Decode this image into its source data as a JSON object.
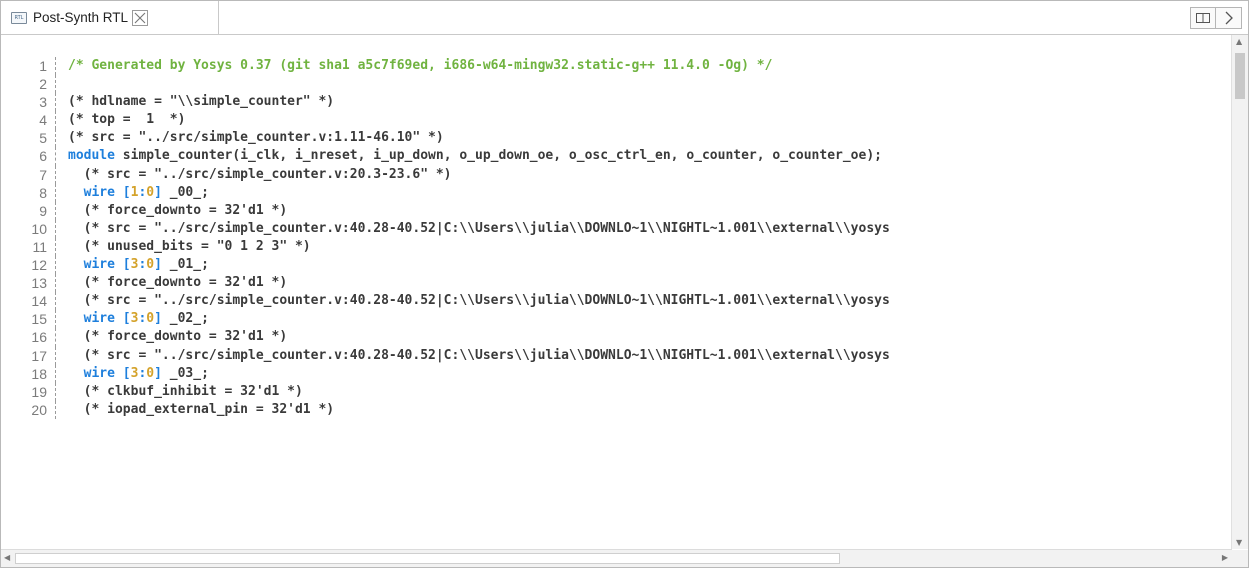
{
  "tab": {
    "label": "Post-Synth RTL",
    "icon_text": "RTL"
  },
  "editor": {
    "line_numbers": [
      "1",
      "2",
      "3",
      "4",
      "5",
      "6",
      "7",
      "8",
      "9",
      "10",
      "11",
      "12",
      "13",
      "14",
      "15",
      "16",
      "17",
      "18",
      "19",
      "20"
    ],
    "lines": [
      [
        {
          "t": "/* Generated by Yosys 0.37 (git sha1 a5c7f69ed, i686-w64-mingw32.static-g++ 11.4.0 -Og) */",
          "c": "cmt"
        }
      ],
      [],
      [
        {
          "t": "(* hdlname = \"\\\\simple_counter\" *)",
          "c": ""
        }
      ],
      [
        {
          "t": "(* top =  1  *)",
          "c": ""
        }
      ],
      [
        {
          "t": "(* src = \"../src/simple_counter.v:1.11-46.10\" *)",
          "c": ""
        }
      ],
      [
        {
          "t": "module",
          "c": "kw"
        },
        {
          "t": " simple_counter(i_clk, i_nreset, i_up_down, o_up_down_oe, o_osc_ctrl_en, o_counter, o_counter_oe);",
          "c": ""
        }
      ],
      [
        {
          "t": "  (* src = \"../src/simple_counter.v:20.3-23.6\" *)",
          "c": ""
        }
      ],
      [
        {
          "t": "  ",
          "c": ""
        },
        {
          "t": "wire",
          "c": "kw"
        },
        {
          "t": " [",
          "c": "kw"
        },
        {
          "t": "1",
          "c": "num"
        },
        {
          "t": ":",
          "c": "kw"
        },
        {
          "t": "0",
          "c": "num"
        },
        {
          "t": "]",
          "c": "kw"
        },
        {
          "t": " _00_;",
          "c": ""
        }
      ],
      [
        {
          "t": "  (* force_downto = 32'd1 *)",
          "c": ""
        }
      ],
      [
        {
          "t": "  (* src = \"../src/simple_counter.v:40.28-40.52|C:\\\\Users\\\\julia\\\\DOWNLO~1\\\\NIGHTL~1.001\\\\external\\\\yosys",
          "c": ""
        }
      ],
      [
        {
          "t": "  (* unused_bits = \"0 1 2 3\" *)",
          "c": ""
        }
      ],
      [
        {
          "t": "  ",
          "c": ""
        },
        {
          "t": "wire",
          "c": "kw"
        },
        {
          "t": " [",
          "c": "kw"
        },
        {
          "t": "3",
          "c": "num"
        },
        {
          "t": ":",
          "c": "kw"
        },
        {
          "t": "0",
          "c": "num"
        },
        {
          "t": "]",
          "c": "kw"
        },
        {
          "t": " _01_;",
          "c": ""
        }
      ],
      [
        {
          "t": "  (* force_downto = 32'd1 *)",
          "c": ""
        }
      ],
      [
        {
          "t": "  (* src = \"../src/simple_counter.v:40.28-40.52|C:\\\\Users\\\\julia\\\\DOWNLO~1\\\\NIGHTL~1.001\\\\external\\\\yosys",
          "c": ""
        }
      ],
      [
        {
          "t": "  ",
          "c": ""
        },
        {
          "t": "wire",
          "c": "kw"
        },
        {
          "t": " [",
          "c": "kw"
        },
        {
          "t": "3",
          "c": "num"
        },
        {
          "t": ":",
          "c": "kw"
        },
        {
          "t": "0",
          "c": "num"
        },
        {
          "t": "]",
          "c": "kw"
        },
        {
          "t": " _02_;",
          "c": ""
        }
      ],
      [
        {
          "t": "  (* force_downto = 32'd1 *)",
          "c": ""
        }
      ],
      [
        {
          "t": "  (* src = \"../src/simple_counter.v:40.28-40.52|C:\\\\Users\\\\julia\\\\DOWNLO~1\\\\NIGHTL~1.001\\\\external\\\\yosys",
          "c": ""
        }
      ],
      [
        {
          "t": "  ",
          "c": ""
        },
        {
          "t": "wire",
          "c": "kw"
        },
        {
          "t": " [",
          "c": "kw"
        },
        {
          "t": "3",
          "c": "num"
        },
        {
          "t": ":",
          "c": "kw"
        },
        {
          "t": "0",
          "c": "num"
        },
        {
          "t": "]",
          "c": "kw"
        },
        {
          "t": " _03_;",
          "c": ""
        }
      ],
      [
        {
          "t": "  (* clkbuf_inhibit = 32'd1 *)",
          "c": ""
        }
      ],
      [
        {
          "t": "  (* iopad_external_pin = 32'd1 *)",
          "c": ""
        }
      ]
    ]
  },
  "icons": {
    "close": "close-icon",
    "split": "split-view-icon",
    "next": "chevron-right-icon"
  },
  "colors": {
    "comment": "#70b340",
    "keyword": "#1e7fdc",
    "number": "#d4a22a",
    "text": "#3a3a3a"
  }
}
